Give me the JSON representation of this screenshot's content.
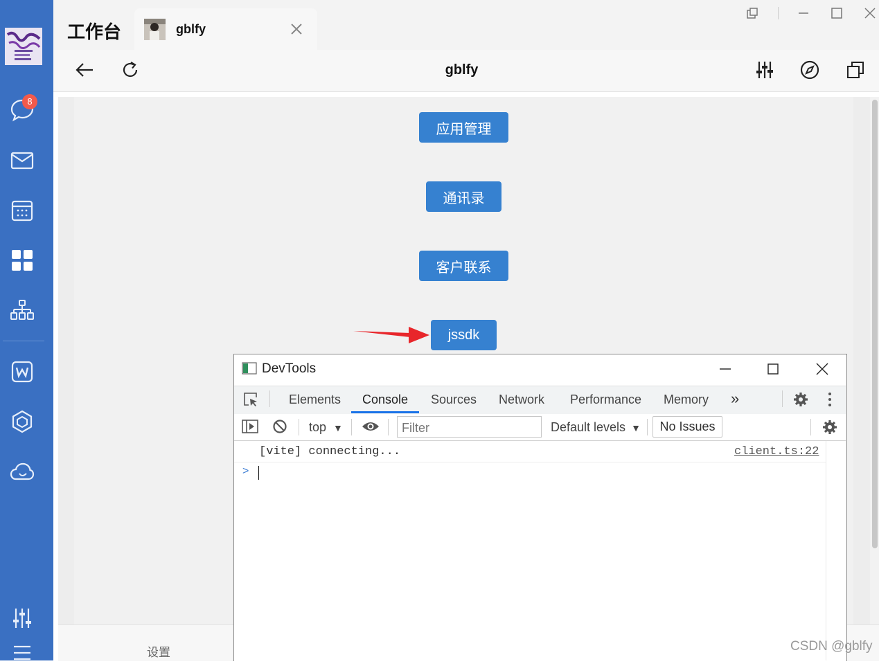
{
  "app": {
    "title": "工作台",
    "tab_label": "gblfy",
    "nav_title": "gblfy"
  },
  "sidebar": {
    "unread_badge": "8",
    "items": [
      {
        "icon": "chat-bubble-icon"
      },
      {
        "icon": "mail-icon"
      },
      {
        "icon": "calendar-icon"
      },
      {
        "icon": "workbench-grid-icon",
        "active": true
      },
      {
        "icon": "org-chart-icon"
      },
      {
        "icon": "word-doc-icon"
      },
      {
        "icon": "cube-icon"
      },
      {
        "icon": "cloud-icon"
      },
      {
        "icon": "sliders-icon"
      },
      {
        "icon": "menu-icon"
      }
    ]
  },
  "page": {
    "buttons": [
      "应用管理",
      "通讯录",
      "客户联系",
      "jssdk"
    ],
    "bottom_label": "设置",
    "watermark": "CSDN @gblfy"
  },
  "devtools": {
    "title": "DevTools",
    "tabs": [
      "Elements",
      "Console",
      "Sources",
      "Network",
      "Performance",
      "Memory"
    ],
    "active_tab": "Console",
    "more_tabs": "»",
    "context": "top",
    "filter_placeholder": "Filter",
    "levels": "Default levels",
    "issues": "No Issues",
    "log": {
      "text": "[vite] connecting...",
      "source": "client.ts:22"
    },
    "prompt": ">"
  },
  "colors": {
    "sidebar": "#3a70c2",
    "button": "#3681d0",
    "arrow": "#e8262b",
    "active_tab_underline": "#1a73e8",
    "badge": "#f25a4b"
  }
}
